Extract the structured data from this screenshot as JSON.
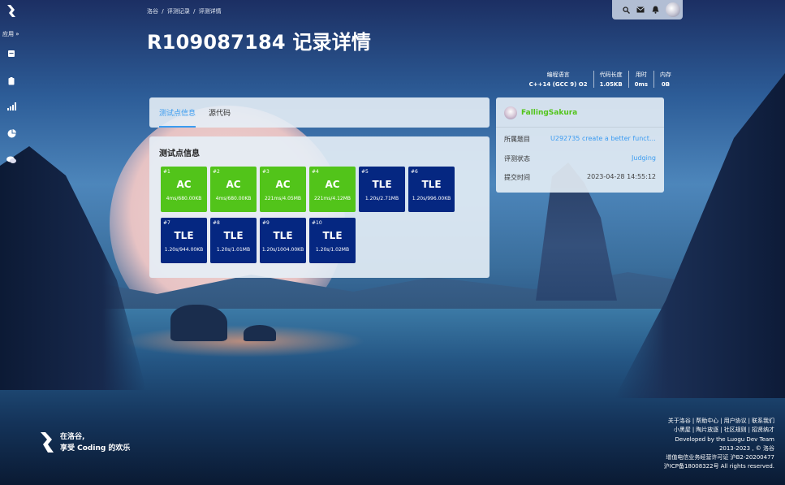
{
  "nav": {
    "app_label": "应用 »",
    "items": [
      "logo-icon",
      "document-icon",
      "clipboard-icon",
      "signal-bars-icon",
      "pie-chart-icon",
      "chat-icon"
    ]
  },
  "breadcrumb": [
    "洛谷",
    "评测记录",
    "评测详情"
  ],
  "breadcrumb_sep": "/",
  "title": "R109087184 记录详情",
  "stats": [
    {
      "label": "编程语言",
      "value": "C++14 (GCC 9) O2"
    },
    {
      "label": "代码长度",
      "value": "1.05KB"
    },
    {
      "label": "用时",
      "value": "0ms"
    },
    {
      "label": "内存",
      "value": "0B"
    }
  ],
  "tabs": [
    {
      "label": "测试点信息",
      "active": true
    },
    {
      "label": "源代码",
      "active": false
    }
  ],
  "tests_title": "测试点信息",
  "testcases": [
    {
      "num": "#1",
      "status": "AC",
      "info": "4ms/680.00KB"
    },
    {
      "num": "#2",
      "status": "AC",
      "info": "4ms/680.00KB"
    },
    {
      "num": "#3",
      "status": "AC",
      "info": "221ms/4.05MB"
    },
    {
      "num": "#4",
      "status": "AC",
      "info": "221ms/4.12MB"
    },
    {
      "num": "#5",
      "status": "TLE",
      "info": "1.20s/2.71MB"
    },
    {
      "num": "#6",
      "status": "TLE",
      "info": "1.20s/996.00KB"
    },
    {
      "num": "#7",
      "status": "TLE",
      "info": "1.20s/944.00KB"
    },
    {
      "num": "#8",
      "status": "TLE",
      "info": "1.20s/1.01MB"
    },
    {
      "num": "#9",
      "status": "TLE",
      "info": "1.20s/1004.00KB"
    },
    {
      "num": "#10",
      "status": "TLE",
      "info": "1.20s/1.02MB"
    }
  ],
  "info": {
    "username": "FallingSakura",
    "problem_label": "所属题目",
    "problem_value": "U292735 create a better functi...",
    "status_label": "评测状态",
    "status_value": "Judging",
    "time_label": "提交时间",
    "time_value": "2023-04-28 14:55:12"
  },
  "slogan": {
    "line1": "在洛谷,",
    "line2": "享受 Coding 的欢乐"
  },
  "footer": {
    "links1": [
      "关于洛谷",
      "帮助中心",
      "用户协议",
      "联系我们"
    ],
    "links2": [
      "小黑屋",
      "陶片放逐",
      "社区规则",
      "招贤纳才"
    ],
    "dev": "Developed by the Luogu Dev Team",
    "copy": "2013-2023 , © 洛谷",
    "license": "增值电信业务经营许可证 沪B2-20200477",
    "icp": "沪ICP备18008322号 All rights reserved."
  },
  "colors": {
    "ac": "#52c41a",
    "tle": "#052781",
    "accent": "#3b9cf0"
  }
}
